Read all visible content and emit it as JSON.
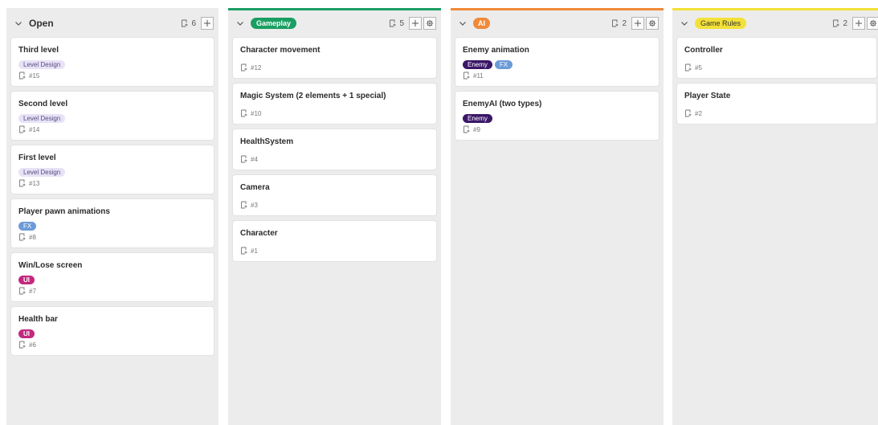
{
  "colors": {
    "column_bg": "#ececec",
    "gameplay": "#1a9e62",
    "ai": "#f08a39",
    "gamerules": "#f3e139",
    "level_design_label": "#e7e2f6",
    "fx_label": "#6b9bd8",
    "ui_label": "#c2287d",
    "enemy_label": "#3b1768"
  },
  "columns": [
    {
      "name": "Open",
      "count": "6",
      "cards": [
        {
          "title": "Third level",
          "labels": [
            "Level Design"
          ],
          "issue": "#15"
        },
        {
          "title": "Second level",
          "labels": [
            "Level Design"
          ],
          "issue": "#14"
        },
        {
          "title": "First level",
          "labels": [
            "Level Design"
          ],
          "issue": "#13"
        },
        {
          "title": "Player pawn animations",
          "labels": [
            "FX"
          ],
          "issue": "#8"
        },
        {
          "title": "Win/Lose screen",
          "labels": [
            "UI"
          ],
          "issue": "#7"
        },
        {
          "title": "Health bar",
          "labels": [
            "UI"
          ],
          "issue": "#6"
        }
      ]
    },
    {
      "name": "Gameplay",
      "count": "5",
      "cards": [
        {
          "title": "Character movement",
          "labels": [],
          "issue": "#12"
        },
        {
          "title": "Magic System (2 elements + 1 special)",
          "labels": [],
          "issue": "#10"
        },
        {
          "title": "HealthSystem",
          "labels": [],
          "issue": "#4"
        },
        {
          "title": "Camera",
          "labels": [],
          "issue": "#3"
        },
        {
          "title": "Character",
          "labels": [],
          "issue": "#1"
        }
      ]
    },
    {
      "name": "AI",
      "count": "2",
      "cards": [
        {
          "title": "Enemy animation",
          "labels": [
            "Enemy",
            "FX"
          ],
          "issue": "#11"
        },
        {
          "title": "EnemyAI (two types)",
          "labels": [
            "Enemy"
          ],
          "issue": "#9"
        }
      ]
    },
    {
      "name": "Game Rules",
      "count": "2",
      "cards": [
        {
          "title": "Controller",
          "labels": [],
          "issue": "#5"
        },
        {
          "title": "Player State",
          "labels": [],
          "issue": "#2"
        }
      ]
    }
  ]
}
